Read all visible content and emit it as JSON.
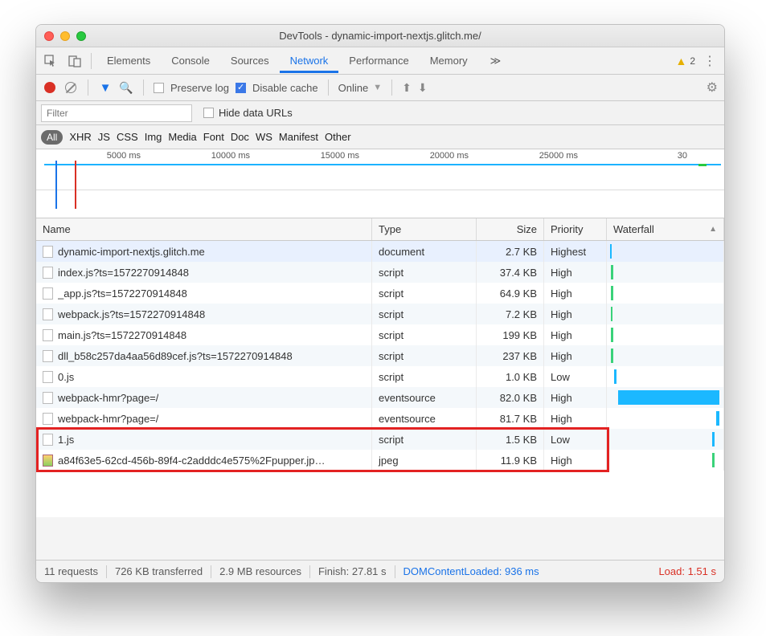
{
  "window": {
    "title": "DevTools - dynamic-import-nextjs.glitch.me/"
  },
  "tabs": {
    "items": [
      "Elements",
      "Console",
      "Sources",
      "Network",
      "Performance",
      "Memory"
    ],
    "active": "Network",
    "more": "≫",
    "warning_count": "2"
  },
  "toolbar": {
    "preserve_log": "Preserve log",
    "disable_cache": "Disable cache",
    "online": "Online"
  },
  "filter": {
    "placeholder": "Filter",
    "hide_data_urls": "Hide data URLs"
  },
  "types": [
    "All",
    "XHR",
    "JS",
    "CSS",
    "Img",
    "Media",
    "Font",
    "Doc",
    "WS",
    "Manifest",
    "Other"
  ],
  "timeline": {
    "ticks": [
      "5000 ms",
      "10000 ms",
      "15000 ms",
      "20000 ms",
      "25000 ms",
      "30"
    ]
  },
  "headers": {
    "name": "Name",
    "type": "Type",
    "size": "Size",
    "priority": "Priority",
    "waterfall": "Waterfall"
  },
  "rows": [
    {
      "name": "dynamic-import-nextjs.glitch.me",
      "type": "document",
      "size": "2.7 KB",
      "priority": "Highest",
      "icon": "file",
      "selected": true,
      "wf": [
        {
          "l": 4,
          "w": 2,
          "c": "#1bb8ff"
        }
      ]
    },
    {
      "name": "index.js?ts=1572270914848",
      "type": "script",
      "size": "37.4 KB",
      "priority": "High",
      "icon": "file",
      "wf": [
        {
          "l": 5,
          "w": 3,
          "c": "#3ad27a"
        }
      ]
    },
    {
      "name": "_app.js?ts=1572270914848",
      "type": "script",
      "size": "64.9 KB",
      "priority": "High",
      "icon": "file",
      "wf": [
        {
          "l": 5,
          "w": 3,
          "c": "#3ad27a"
        }
      ]
    },
    {
      "name": "webpack.js?ts=1572270914848",
      "type": "script",
      "size": "7.2 KB",
      "priority": "High",
      "icon": "file",
      "wf": [
        {
          "l": 5,
          "w": 2,
          "c": "#3ad27a"
        }
      ]
    },
    {
      "name": "main.js?ts=1572270914848",
      "type": "script",
      "size": "199 KB",
      "priority": "High",
      "icon": "file",
      "wf": [
        {
          "l": 5,
          "w": 3,
          "c": "#3ad27a"
        }
      ]
    },
    {
      "name": "dll_b58c257da4aa56d89cef.js?ts=1572270914848",
      "type": "script",
      "size": "237 KB",
      "priority": "High",
      "icon": "file",
      "wf": [
        {
          "l": 5,
          "w": 3,
          "c": "#3ad27a"
        }
      ]
    },
    {
      "name": "0.js",
      "type": "script",
      "size": "1.0 KB",
      "priority": "Low",
      "icon": "file",
      "wf": [
        {
          "l": 9,
          "w": 3,
          "c": "#1bb8ff"
        }
      ]
    },
    {
      "name": "webpack-hmr?page=/",
      "type": "eventsource",
      "size": "82.0 KB",
      "priority": "High",
      "icon": "file",
      "wf": [
        {
          "l": 14,
          "w": 126,
          "c": "#1bb8ff"
        }
      ]
    },
    {
      "name": "webpack-hmr?page=/",
      "type": "eventsource",
      "size": "81.7 KB",
      "priority": "High",
      "icon": "file",
      "wf": [
        {
          "l": 136,
          "w": 4,
          "c": "#1bb8ff"
        }
      ]
    },
    {
      "name": "1.js",
      "type": "script",
      "size": "1.5 KB",
      "priority": "Low",
      "icon": "file",
      "wf": [
        {
          "l": 131,
          "w": 3,
          "c": "#1bb8ff"
        }
      ]
    },
    {
      "name": "a84f63e5-62cd-456b-89f4-c2adddc4e575%2Fpupper.jp…",
      "type": "jpeg",
      "size": "11.9 KB",
      "priority": "High",
      "icon": "img",
      "wf": [
        {
          "l": 131,
          "w": 3,
          "c": "#3ad27a"
        }
      ]
    }
  ],
  "status": {
    "requests": "11 requests",
    "transferred": "726 KB transferred",
    "resources": "2.9 MB resources",
    "finish": "Finish: 27.81 s",
    "dcl": "DOMContentLoaded: 936 ms",
    "load": "Load: 1.51 s"
  }
}
